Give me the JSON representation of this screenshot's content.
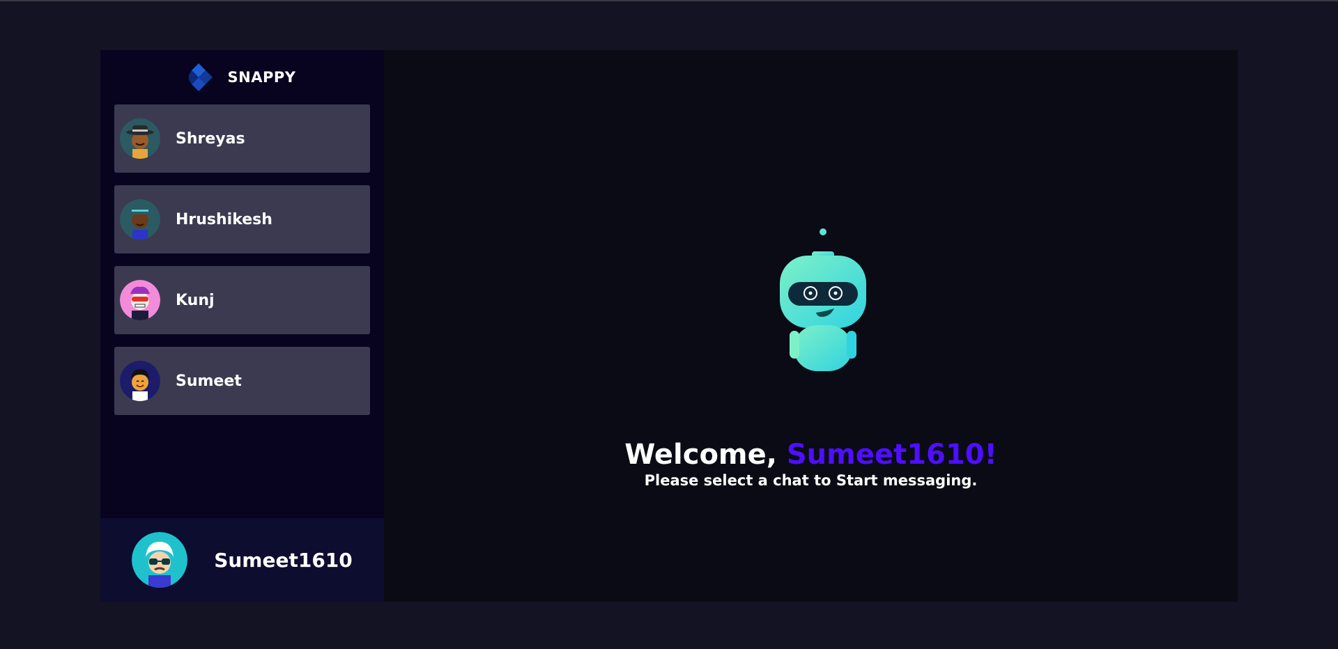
{
  "brand": {
    "name": "SNAPPY",
    "logo_icon": "snappy-logo-icon"
  },
  "contacts": [
    {
      "name": "Shreyas",
      "avatar_icon": "avatar-hat-man-icon"
    },
    {
      "name": "Hrushikesh",
      "avatar_icon": "avatar-cap-man-icon"
    },
    {
      "name": "Kunj",
      "avatar_icon": "avatar-masked-icon"
    },
    {
      "name": "Sumeet",
      "avatar_icon": "avatar-smiling-man-icon"
    }
  ],
  "current_user": {
    "name": "Sumeet1610",
    "avatar_icon": "avatar-glasses-icon"
  },
  "welcome": {
    "greeting": "Welcome, ",
    "username": "Sumeet1610!",
    "subtitle": "Please select a chat to Start messaging."
  },
  "colors": {
    "accent": "#4e0eff",
    "sidebar_bg": "#080420",
    "contact_bg": "#3c3a51",
    "page_bg": "#131324"
  }
}
